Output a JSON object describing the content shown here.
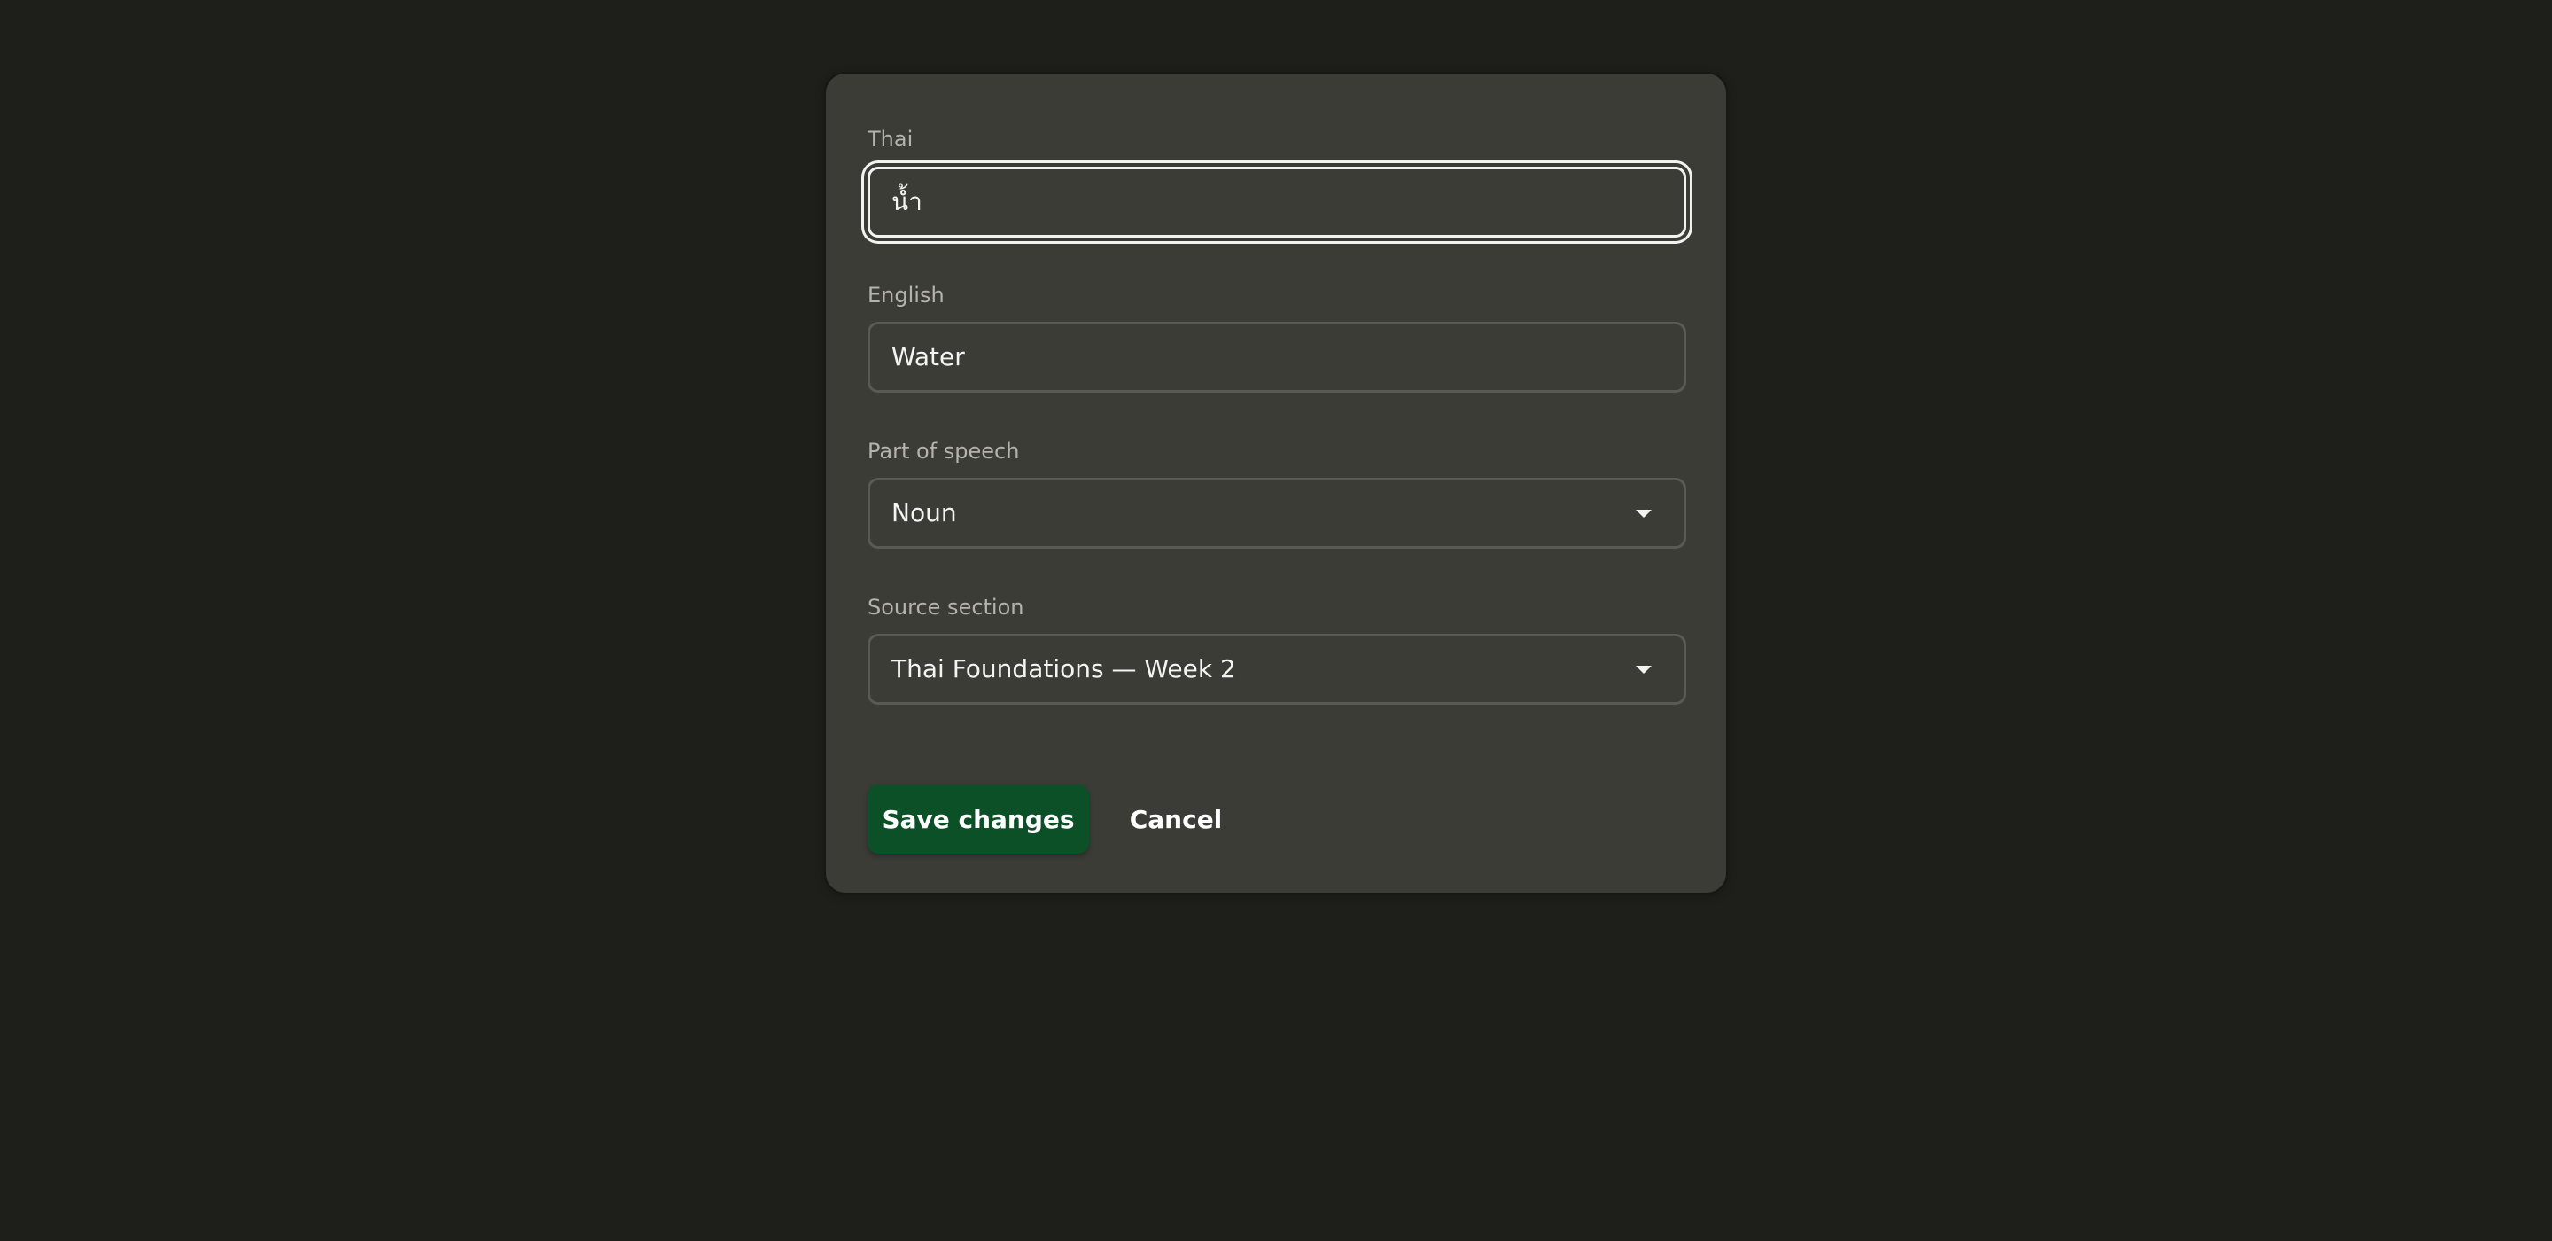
{
  "form": {
    "thai": {
      "label": "Thai",
      "value": "น้ำ"
    },
    "english": {
      "label": "English",
      "value": "Water"
    },
    "part_of_speech": {
      "label": "Part of speech",
      "selected": "Noun"
    },
    "source_section": {
      "label": "Source section",
      "selected": "Thai Foundations — Week 2"
    }
  },
  "actions": {
    "save_label": "Save changes",
    "cancel_label": "Cancel"
  },
  "icons": {
    "dropdown": "chevron-down-icon"
  },
  "colors": {
    "background": "#1e1e1a",
    "panel": "#3c3c37",
    "primary_button": "#0b5027",
    "focus_ring": "#f2f2ee"
  }
}
